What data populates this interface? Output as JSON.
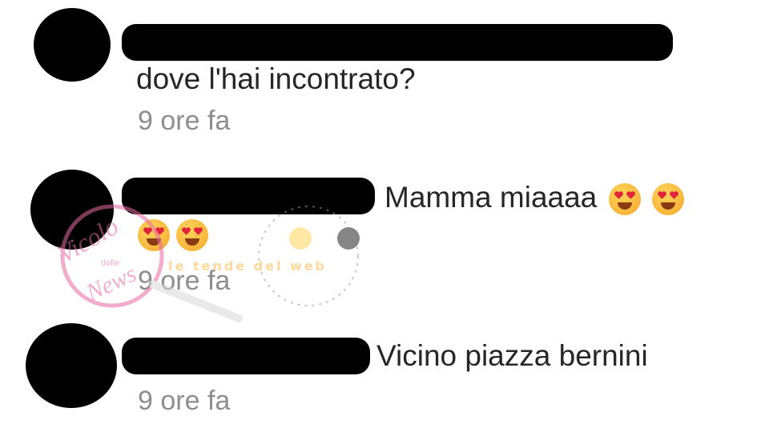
{
  "comments": [
    {
      "text": "dove l'hai incontrato?",
      "time": "9 ore fa"
    },
    {
      "text": "Mamma miaaaa",
      "time": "9 ore fa",
      "emoji_icons": [
        "heart-eyes-emoji",
        "heart-eyes-emoji",
        "heart-eyes-emoji",
        "heart-eyes-emoji"
      ]
    },
    {
      "text": "Vicino piazza bernini",
      "time": "9 ore fa"
    }
  ],
  "watermark": {
    "text_main": "Vicolo",
    "text_small": "delle",
    "text_bottom": "News",
    "tagline": "le tende del web"
  },
  "colors": {
    "text": "#262626",
    "time": "#8e8e8e",
    "redaction": "#000000",
    "watermark_pink": "#e86aa4"
  }
}
